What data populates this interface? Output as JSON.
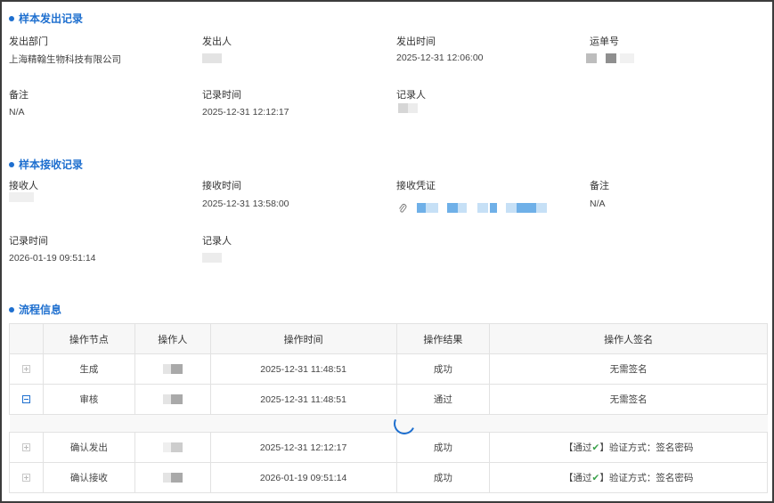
{
  "dispatch": {
    "title": "样本发出记录",
    "dept_label": "发出部门",
    "dept_value": "上海精翰生物科技有限公司",
    "sender_label": "发出人",
    "time_label": "发出时间",
    "time_value": "2025-12-31 12:06:00",
    "waybill_label": "运单号",
    "remark_label": "备注",
    "remark_value": "N/A",
    "record_time_label": "记录时间",
    "record_time_value": "2025-12-31 12:12:17",
    "recorder_label": "记录人"
  },
  "receive": {
    "title": "样本接收记录",
    "receiver_label": "接收人",
    "time_label": "接收时间",
    "time_value": "2025-12-31 13:58:00",
    "voucher_label": "接收凭证",
    "remark_label": "备注",
    "remark_value": "N/A",
    "record_time_label": "记录时间",
    "record_time_value": "2026-01-19 09:51:14",
    "recorder_label": "记录人"
  },
  "flow": {
    "title": "流程信息",
    "headers": [
      "",
      "操作节点",
      "操作人",
      "操作时间",
      "操作结果",
      "操作人签名"
    ],
    "rows": [
      {
        "node": "生成",
        "time": "2025-12-31 11:48:51",
        "result": "成功",
        "sign_text": "无需签名"
      },
      {
        "node": "审核",
        "time": "2025-12-31 11:48:51",
        "result": "通过",
        "sign_text": "无需签名"
      },
      {
        "node": "确认发出",
        "time": "2025-12-31 12:12:17",
        "result": "成功",
        "sign_prefix": "【通过",
        "sign_suffix": "】验证方式：签名密码"
      },
      {
        "node": "确认接收",
        "time": "2026-01-19 09:51:14",
        "result": "成功",
        "sign_prefix": "【通过",
        "sign_suffix": "】验证方式：签名密码"
      }
    ]
  },
  "icons": {
    "expand": "plus-square-icon",
    "collapse": "minus-square-icon",
    "attachment": "paperclip-icon",
    "check": "check-icon",
    "loading": "spinner-icon"
  },
  "colors": {
    "accent": "#1e6fcf",
    "success": "#3aa14a"
  }
}
